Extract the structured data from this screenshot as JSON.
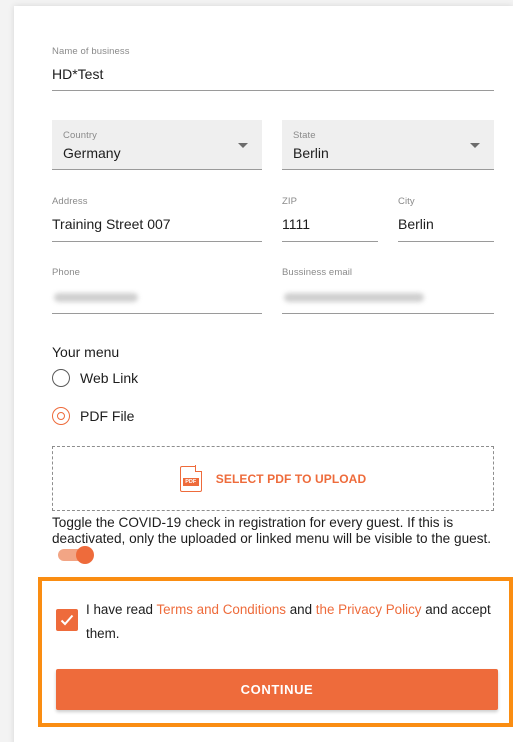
{
  "form": {
    "business_name": {
      "label": "Name of business",
      "value": "HD*Test"
    },
    "country": {
      "label": "Country",
      "value": "Germany"
    },
    "state": {
      "label": "State",
      "value": "Berlin"
    },
    "address": {
      "label": "Address",
      "value": "Training Street 007"
    },
    "zip": {
      "label": "ZIP",
      "value": "1111"
    },
    "city": {
      "label": "City",
      "value": "Berlin"
    },
    "phone": {
      "label": "Phone"
    },
    "email": {
      "label": "Bussiness email"
    }
  },
  "menu": {
    "title": "Your menu",
    "options": [
      {
        "label": "Web Link",
        "checked": false
      },
      {
        "label": "PDF File",
        "checked": true
      }
    ],
    "upload_label": "SELECT PDF TO UPLOAD",
    "upload_icon_text": "PDF",
    "upload_icon": "pdf-file-icon"
  },
  "covid": {
    "text": "Toggle the COVID-19 check in registration for every guest. If this is deactivated, only the uploaded or linked menu will be visible to the guest.",
    "enabled": true
  },
  "consent": {
    "checked": true,
    "part1": "I have read ",
    "terms_link": "Terms and Conditions",
    "part2": " and ",
    "privacy_link": "the Privacy Policy",
    "part3": " and accept them."
  },
  "continue_label": "CONTINUE",
  "colors": {
    "accent": "#ee6b3b",
    "highlight_border": "#fa8d12"
  }
}
